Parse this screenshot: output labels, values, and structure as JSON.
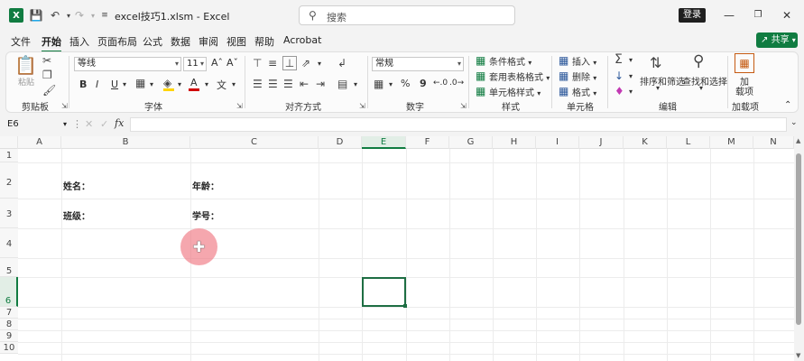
{
  "titlebar": {
    "file_name": "excel技巧1.xlsm",
    "separator": "-",
    "app_name": "Excel",
    "search_placeholder": "搜索",
    "login_label": "登录"
  },
  "menu": {
    "tabs": [
      "文件",
      "开始",
      "插入",
      "页面布局",
      "公式",
      "数据",
      "审阅",
      "视图",
      "帮助",
      "Acrobat"
    ],
    "active_tab": "开始",
    "share_label": "共享"
  },
  "ribbon": {
    "clipboard": {
      "paste_label": "粘贴",
      "group_label": "剪贴板"
    },
    "font": {
      "font_name": "等线",
      "font_size": "11",
      "bold": "B",
      "italic": "I",
      "underline": "U",
      "group_label": "字体"
    },
    "alignment": {
      "group_label": "对齐方式"
    },
    "number": {
      "format": "常规",
      "percent": "%",
      "comma": "9",
      "group_label": "数字"
    },
    "styles": {
      "conditional": "条件格式",
      "table": "套用表格格式",
      "cell": "单元格样式",
      "group_label": "样式"
    },
    "cells": {
      "insert": "插入",
      "delete": "删除",
      "format": "格式",
      "group_label": "单元格"
    },
    "editing": {
      "sort": "排序和筛选",
      "find": "查找和选择",
      "group_label": "编辑"
    },
    "addins": {
      "label_line1": "加",
      "label_line2": "载项",
      "group_label": "加载项"
    }
  },
  "formula_bar": {
    "name_box": "E6",
    "fx": "fx",
    "content": ""
  },
  "sheet": {
    "columns": [
      "A",
      "B",
      "C",
      "D",
      "E",
      "F",
      "G",
      "H",
      "I",
      "J",
      "K",
      "L",
      "M",
      "N"
    ],
    "rows": [
      "1",
      "2",
      "3",
      "4",
      "5",
      "6",
      "7",
      "8",
      "9",
      "10"
    ],
    "selected_column": "E",
    "selected_row": "6",
    "cells": {
      "B2": "姓名：",
      "C2": "年龄：",
      "B3": "班级：",
      "C3": "学号："
    }
  },
  "colors": {
    "accent": "#107c41",
    "cursor_halo": "#f07882"
  }
}
